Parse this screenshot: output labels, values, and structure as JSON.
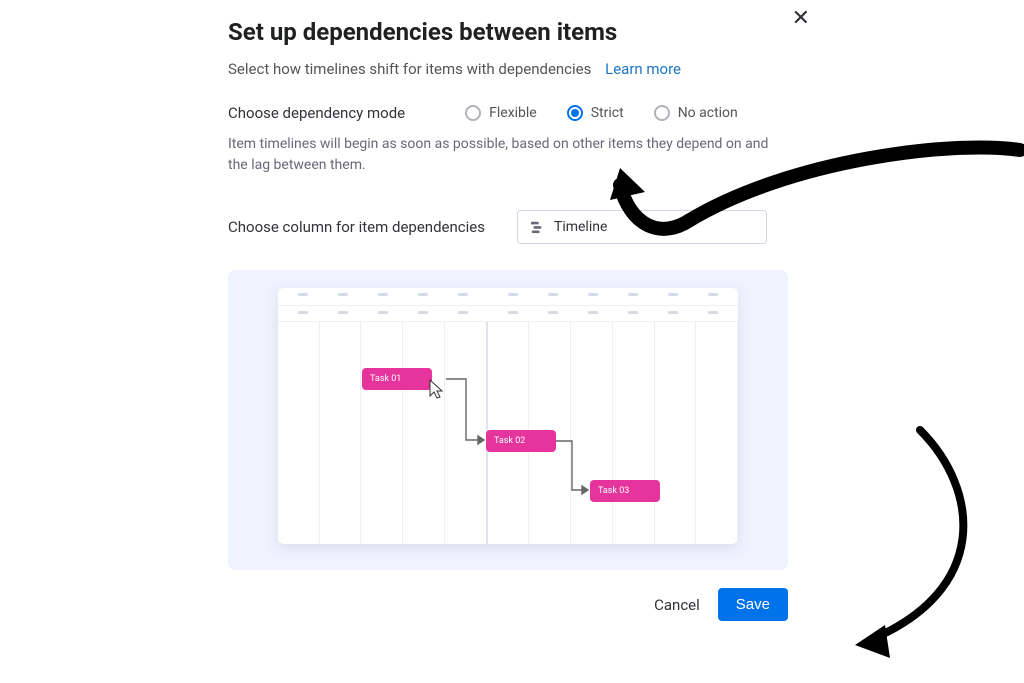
{
  "modal": {
    "title": "Set up dependencies between items",
    "subtitle": "Select how timelines shift for items with dependencies",
    "learn_more": "Learn more",
    "close": "✕",
    "mode_label": "Choose dependency mode",
    "options": [
      {
        "label": "Flexible",
        "selected": false
      },
      {
        "label": "Strict",
        "selected": true
      },
      {
        "label": "No action",
        "selected": false
      }
    ],
    "description": "Item timelines will begin as soon as possible, based on other items they depend on and the lag between them.",
    "column_label": "Choose column for item dependencies",
    "dropdown_value": "Timeline",
    "preview_tasks": [
      {
        "label": "Task 01"
      },
      {
        "label": "Task 02"
      },
      {
        "label": "Task 03"
      }
    ],
    "cancel": "Cancel",
    "save": "Save"
  }
}
